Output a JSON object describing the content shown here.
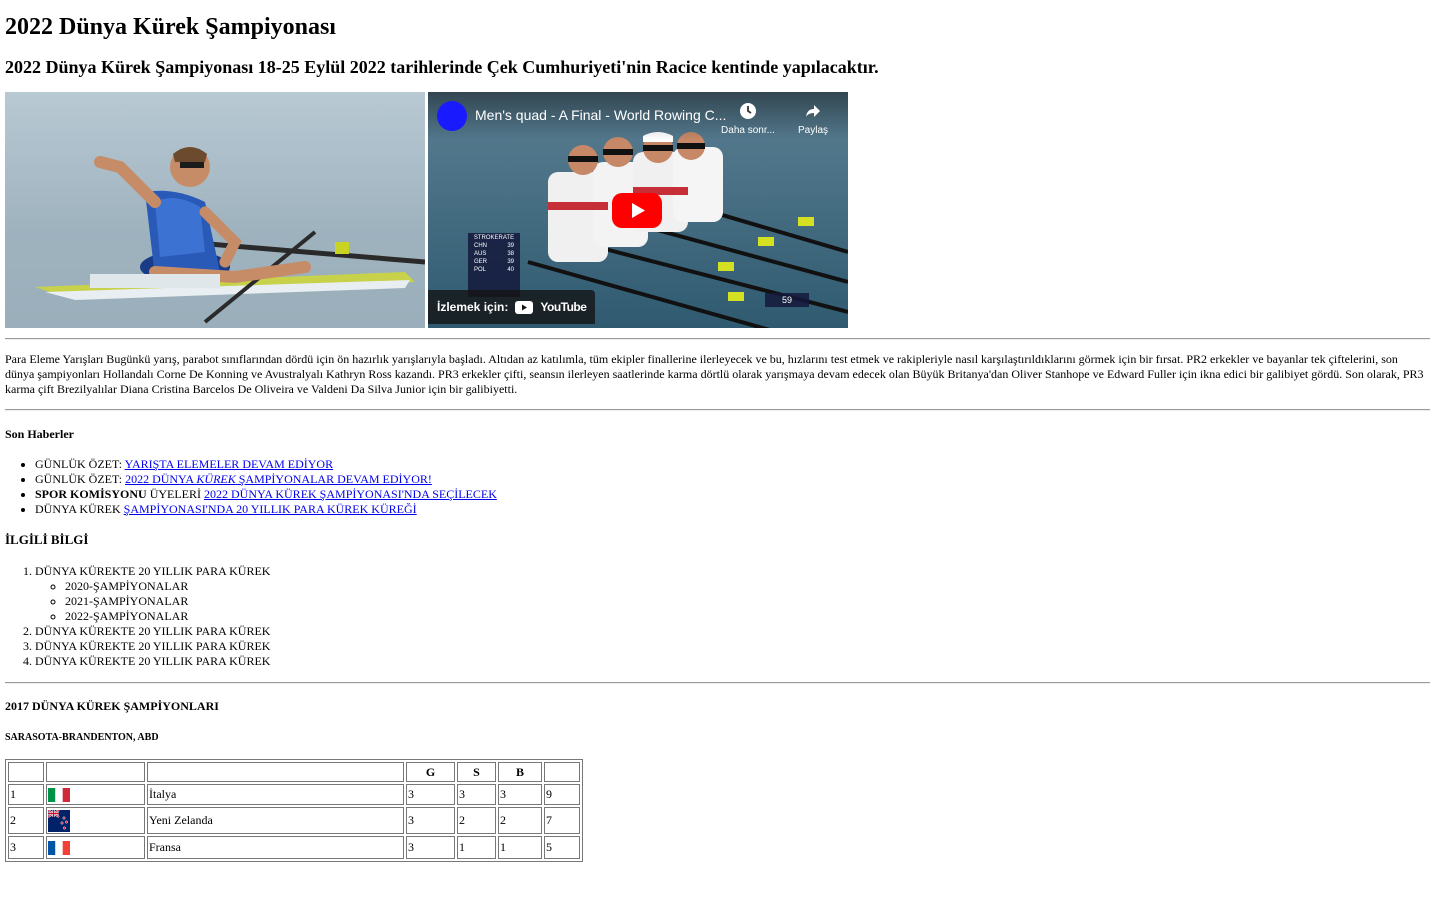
{
  "page": {
    "title": "2022 Dünya Kürek Şampiyonası",
    "subtitle": "2022 Dünya Kürek Şampiyonası 18-25 Eylül 2022 tarihlerinde Çek Cumhuriyeti'nin Racice kentinde yapılacaktır."
  },
  "video": {
    "title": "Men's quad - A Final - World Rowing C...",
    "later_label": "Daha sonr...",
    "share_label": "Paylaş",
    "watch_label": "İzlemek için:",
    "youtube_label": "YouTube",
    "scoreboard": {
      "header": "STROKERATE",
      "rows": [
        {
          "country": "CHN",
          "rate": "39"
        },
        {
          "country": "AUS",
          "rate": "38"
        },
        {
          "country": "GER",
          "rate": "39"
        },
        {
          "country": "POL",
          "rate": "40"
        }
      ],
      "lane_number": "59"
    }
  },
  "article": {
    "text": "Para Eleme Yarışları Bugünkü yarış, parabot sınıflarından dördü için ön hazırlık yarışlarıyla başladı. Altıdan az katılımla, tüm ekipler finallerine ilerleyecek ve bu, hızlarını test etmek ve rakipleriyle nasıl karşılaştırıldıklarını görmek için bir fırsat. PR2 erkekler ve bayanlar tek çiftelerini, son dünya şampiyonları Hollandalı Corne De Konning ve Avustralyalı Kathryn Ross kazandı. PR3 erkekler çifti, seansın ilerleyen saatlerinde karma dörtlü olarak yarışmaya devam edecek olan Büyük Britanya'dan Oliver Stanhope ve Edward Fuller için ikna edici bir galibiyet gördü. Son olarak, PR3 karma çift Brezilyalılar Diana Cristina Barcelos De Oliveira ve Valdeni Da Silva Junior için bir galibiyetti."
  },
  "news": {
    "heading": "Son Haberler",
    "items": [
      {
        "prefix": "GÜNLÜK ÖZET: ",
        "link": "YARIŞTA ELEMELER DEVAM EDİYOR"
      },
      {
        "prefix": "GÜNLÜK ÖZET: ",
        "link_a": "2022 DÜNYA ",
        "link_em": "KÜREK",
        "link_b": " ŞAMPİYONALAR DEVAM EDİYOR!"
      },
      {
        "bold": "SPOR KOMİSYONU",
        "prefix": " ÜYELERİ ",
        "link": "2022 DÜNYA KÜREK ŞAMPİYONASI'NDA SEÇİLECEK"
      },
      {
        "prefix": "DÜNYA KÜREK ",
        "link": "ŞAMPİYONASI'NDA 20 YILLIK PARA KÜREK KÜREĞİ"
      }
    ]
  },
  "info": {
    "heading": "İLGİLİ BİLGİ",
    "items": [
      "DÜNYA KÜREKTE 20 YILLIK PARA KÜREK",
      "DÜNYA KÜREKTE 20 YILLIK PARA KÜREK",
      "DÜNYA KÜREKTE 20 YILLIK PARA KÜREK",
      "DÜNYA KÜREKTE 20 YILLIK PARA KÜREK"
    ],
    "subitems": [
      "2020-ŞAMPİYONALAR",
      "2021-ŞAMPİYONALAR",
      "2022-ŞAMPİYONALAR"
    ]
  },
  "results": {
    "heading": "2017 DÜNYA KÜREK ŞAMPİYONLARI",
    "location": "SARASOTA-BRANDENTON, ABD",
    "columns": [
      "",
      "",
      "",
      "G",
      "S",
      "B",
      ""
    ],
    "rows": [
      {
        "rank": "1",
        "flag": "flag-italy-icon",
        "country": "İtalya",
        "g": "3",
        "s": "3",
        "b": "3",
        "total": "9"
      },
      {
        "rank": "2",
        "flag": "flag-new-zealand-icon",
        "country": "Yeni Zelanda",
        "g": "3",
        "s": "2",
        "b": "2",
        "total": "7"
      },
      {
        "rank": "3",
        "flag": "flag-france-icon",
        "country": "Fransa",
        "g": "3",
        "s": "1",
        "b": "1",
        "total": "5"
      }
    ]
  },
  "colors": {
    "link": "#0000ee",
    "youtube_red": "#ff0000",
    "rule": "#9a9a9a"
  }
}
